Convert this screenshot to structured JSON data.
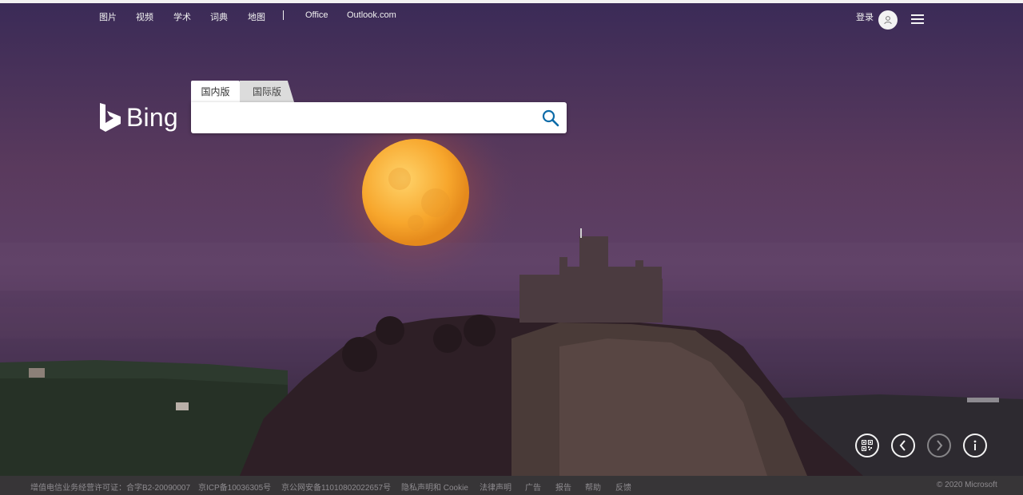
{
  "nav": {
    "items": [
      "图片",
      "视频",
      "学术",
      "词典",
      "地图"
    ],
    "office": "Office",
    "outlook": "Outlook.com"
  },
  "account": {
    "login_label": "登录"
  },
  "brand": {
    "logo_text": "Bing"
  },
  "search": {
    "tabs": [
      "国内版",
      "国际版"
    ],
    "active_tab": "国内版",
    "value": "",
    "placeholder": ""
  },
  "footer": {
    "links": [
      "增值电信业务经营许可证：合字B2-20090007",
      "京ICP备10036305号",
      "京公网安备11010802022657号",
      "隐私声明和 Cookie",
      "法律声明",
      "广告",
      "报告",
      "帮助",
      "反馈"
    ],
    "copyright": "© 2020 Microsoft"
  },
  "colors": {
    "search_icon": "#0c6ba8",
    "footer_bg": "#373537",
    "footer_text": "#8e8b8f",
    "moon": "#f2a329"
  },
  "icons": {
    "controls": [
      "qr-code-icon",
      "previous-image-icon",
      "next-image-icon",
      "info-icon"
    ]
  }
}
